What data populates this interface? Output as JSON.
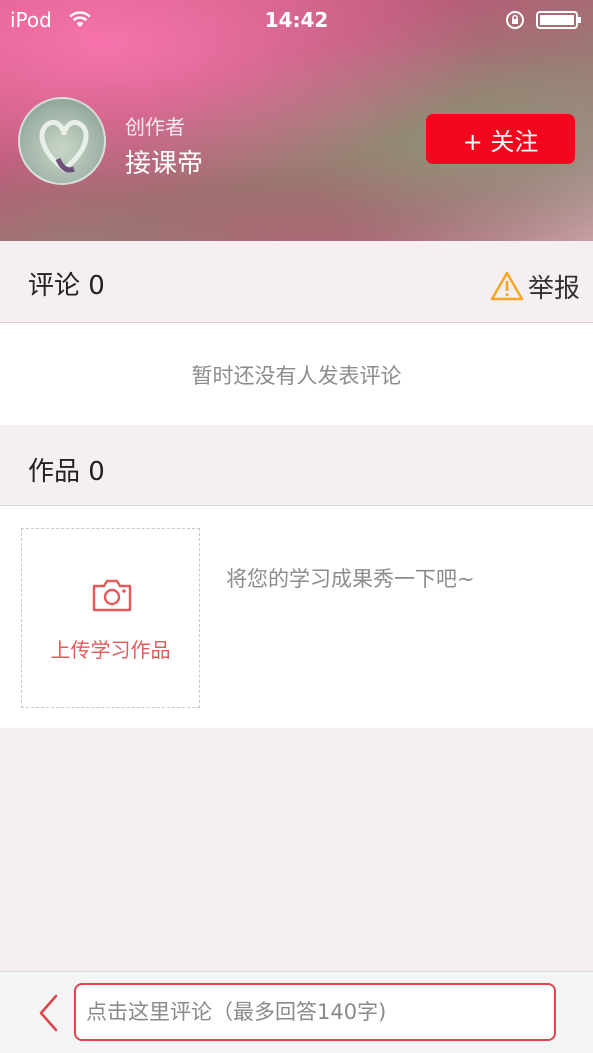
{
  "status": {
    "carrier": "iPod",
    "time": "14:42"
  },
  "creator": {
    "role": "创作者",
    "name": "接课帝",
    "follow_label": "+ 关注"
  },
  "comments": {
    "title": "评论 0",
    "report_label": "举报",
    "empty_text": "暂时还没有人发表评论"
  },
  "works": {
    "title": "作品 0",
    "upload_label": "上传学习作品",
    "hint": "将您的学习成果秀一下吧~"
  },
  "comment_bar": {
    "placeholder": "点击这里评论（最多回答140字)"
  },
  "colors": {
    "accent": "#f2051d",
    "upload_text": "#e25a5a",
    "warning": "#f5a623"
  },
  "icons": [
    "wifi-icon",
    "lock-rotation-icon",
    "battery-icon",
    "warning-icon",
    "camera-icon",
    "back-chevron-icon"
  ]
}
